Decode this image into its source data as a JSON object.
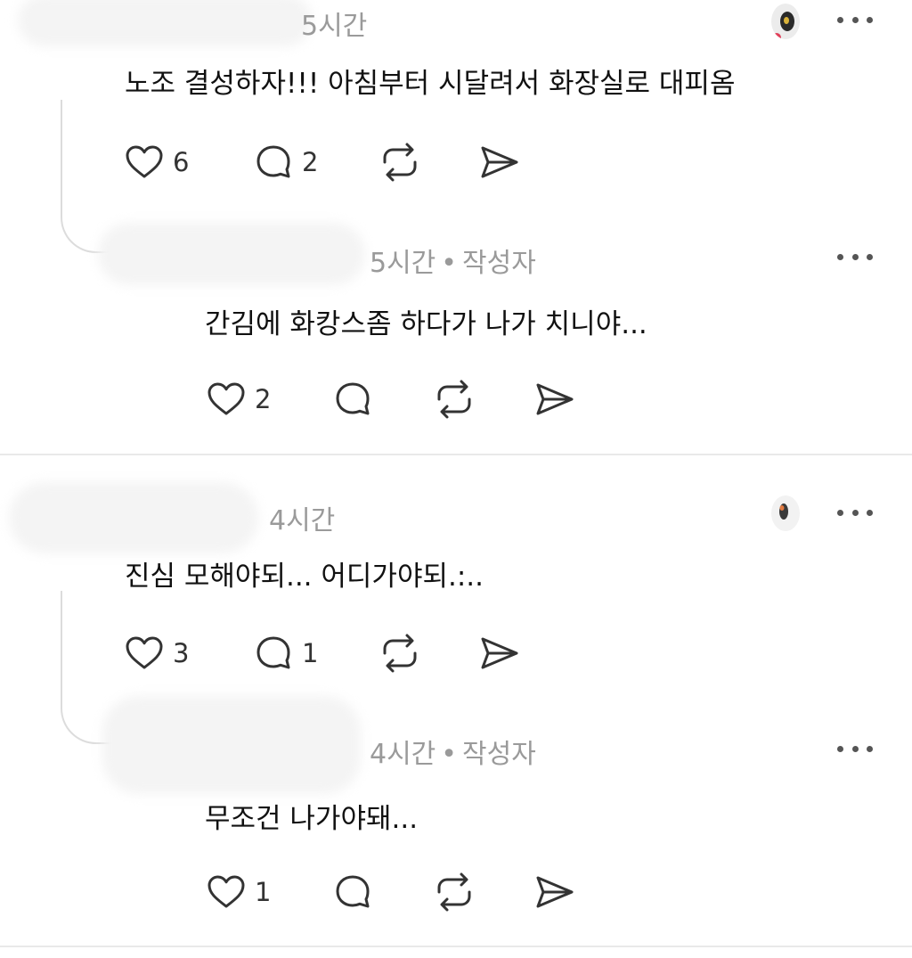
{
  "threads": [
    {
      "comment": {
        "time": "5시간",
        "text": "노조 결성하자!!! 아침부터 시달려서 화장실로 대피옴",
        "likes": "6",
        "replies": "2"
      },
      "reply": {
        "time": "5시간",
        "author_badge": "작성자",
        "text": "간김에 화캉스좀 하다가 나가 치니야...",
        "likes": "2"
      }
    },
    {
      "comment": {
        "time": "4시간",
        "text": "진심 모해야되... 어디가야되.:..",
        "likes": "3",
        "replies": "1"
      },
      "reply": {
        "time": "4시간",
        "author_badge": "작성자",
        "text": "무조건 나가야돼...",
        "likes": "1"
      }
    }
  ],
  "separator_dot": "•",
  "icons": {
    "like": "heart-icon",
    "reply": "comment-bubble-icon",
    "repost": "repost-icon",
    "share": "send-icon",
    "more": "more-options-icon"
  },
  "colors": {
    "text": "#111111",
    "meta": "#9a9a9a",
    "icon": "#333333",
    "divider": "#e9e9e9"
  }
}
